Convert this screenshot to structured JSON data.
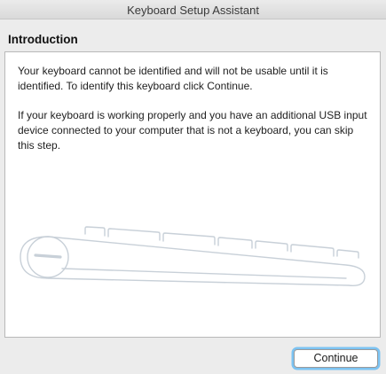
{
  "window": {
    "title": "Keyboard Setup Assistant"
  },
  "page": {
    "heading": "Introduction",
    "paragraph1": "Your keyboard cannot be identified and will not be usable until it is identified. To identify this keyboard click Continue.",
    "paragraph2": "If your keyboard is working properly and you have an additional USB input device connected to your computer that is not a keyboard, you can skip this step."
  },
  "illustration": {
    "icon": "keyboard-outline-icon",
    "stroke_color": "#c8d0d8"
  },
  "buttons": {
    "continue_label": "Continue",
    "focus_ring_color": "#7cc3f2"
  }
}
